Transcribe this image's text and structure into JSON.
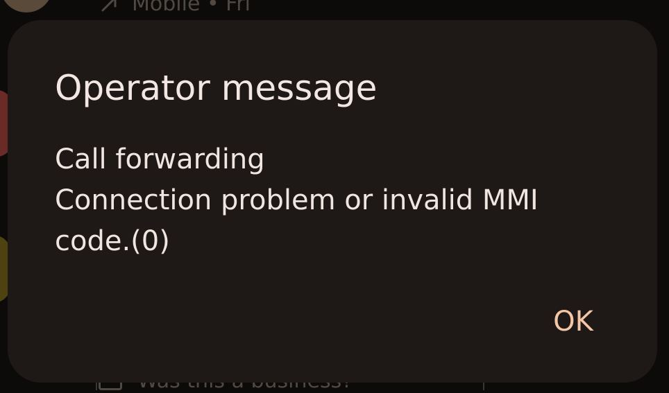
{
  "background": {
    "top_row_text": "Mobile • Fri",
    "bottom_row_text": "Was this a business?"
  },
  "dialog": {
    "title": "Operator message",
    "lines": [
      "Call forwarding",
      "Connection problem or invalid MMI",
      "code.(0)"
    ],
    "ok_label": "OK"
  },
  "colors": {
    "scrim": "#0d0b0a",
    "dialog_surface": "#1e1917",
    "title_text": "#f2e7e2",
    "accent": "#f4c6a5"
  },
  "icons": {
    "top_row": "outgoing-call-arrow-icon",
    "bottom_row": "chat-bubble-icon"
  }
}
